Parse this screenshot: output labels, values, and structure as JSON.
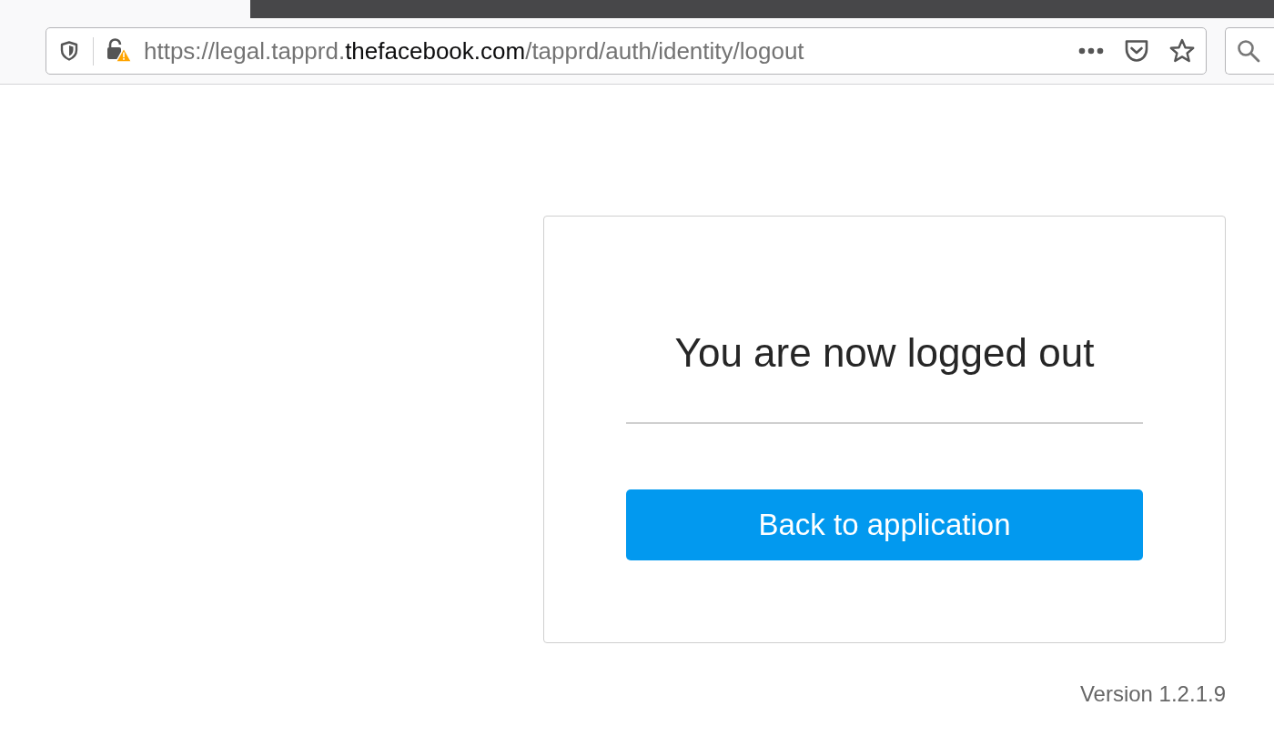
{
  "browser": {
    "url": {
      "prefix": "https://legal.tapprd.",
      "domain": "thefacebook.com",
      "path": "/tapprd/auth/identity/logout"
    }
  },
  "card": {
    "title": "You are now logged out",
    "button": "Back to application"
  },
  "version": "Version 1.2.1.9"
}
